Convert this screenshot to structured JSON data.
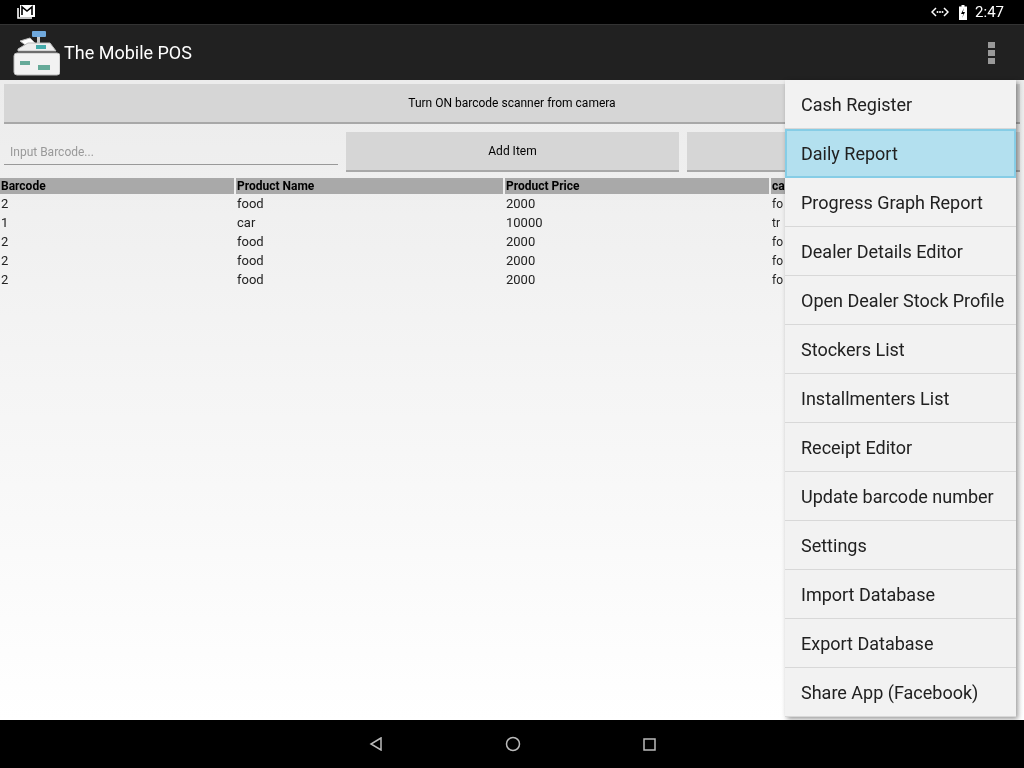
{
  "status_bar": {
    "time": "2:47"
  },
  "app_bar": {
    "title": "The Mobile POS"
  },
  "scanner_button": "Turn ON barcode scanner from camera",
  "barcode_field": {
    "placeholder": "Input Barcode..."
  },
  "add_button": "Add Item",
  "table": {
    "columns": [
      "Barcode",
      "Product Name",
      "Product Price",
      "ca"
    ],
    "rows": [
      [
        "2",
        "food",
        "2000",
        "fo"
      ],
      [
        "1",
        "car",
        "10000",
        "tr"
      ],
      [
        "2",
        "food",
        "2000",
        "fo"
      ],
      [
        "2",
        "food",
        "2000",
        "fo"
      ],
      [
        "2",
        "food",
        "2000",
        "fo"
      ]
    ]
  },
  "menu": [
    {
      "label": "Cash Register",
      "selected": false
    },
    {
      "label": "Daily Report",
      "selected": true
    },
    {
      "label": "Progress Graph Report",
      "selected": false
    },
    {
      "label": "Dealer Details Editor",
      "selected": false
    },
    {
      "label": "Open Dealer Stock Profile",
      "selected": false
    },
    {
      "label": "Stockers List",
      "selected": false
    },
    {
      "label": "Installmenters List",
      "selected": false
    },
    {
      "label": "Receipt Editor",
      "selected": false
    },
    {
      "label": "Update barcode number",
      "selected": false
    },
    {
      "label": "Settings",
      "selected": false
    },
    {
      "label": "Import Database",
      "selected": false
    },
    {
      "label": "Export Database",
      "selected": false
    },
    {
      "label": "Share App (Facebook)",
      "selected": false
    }
  ]
}
